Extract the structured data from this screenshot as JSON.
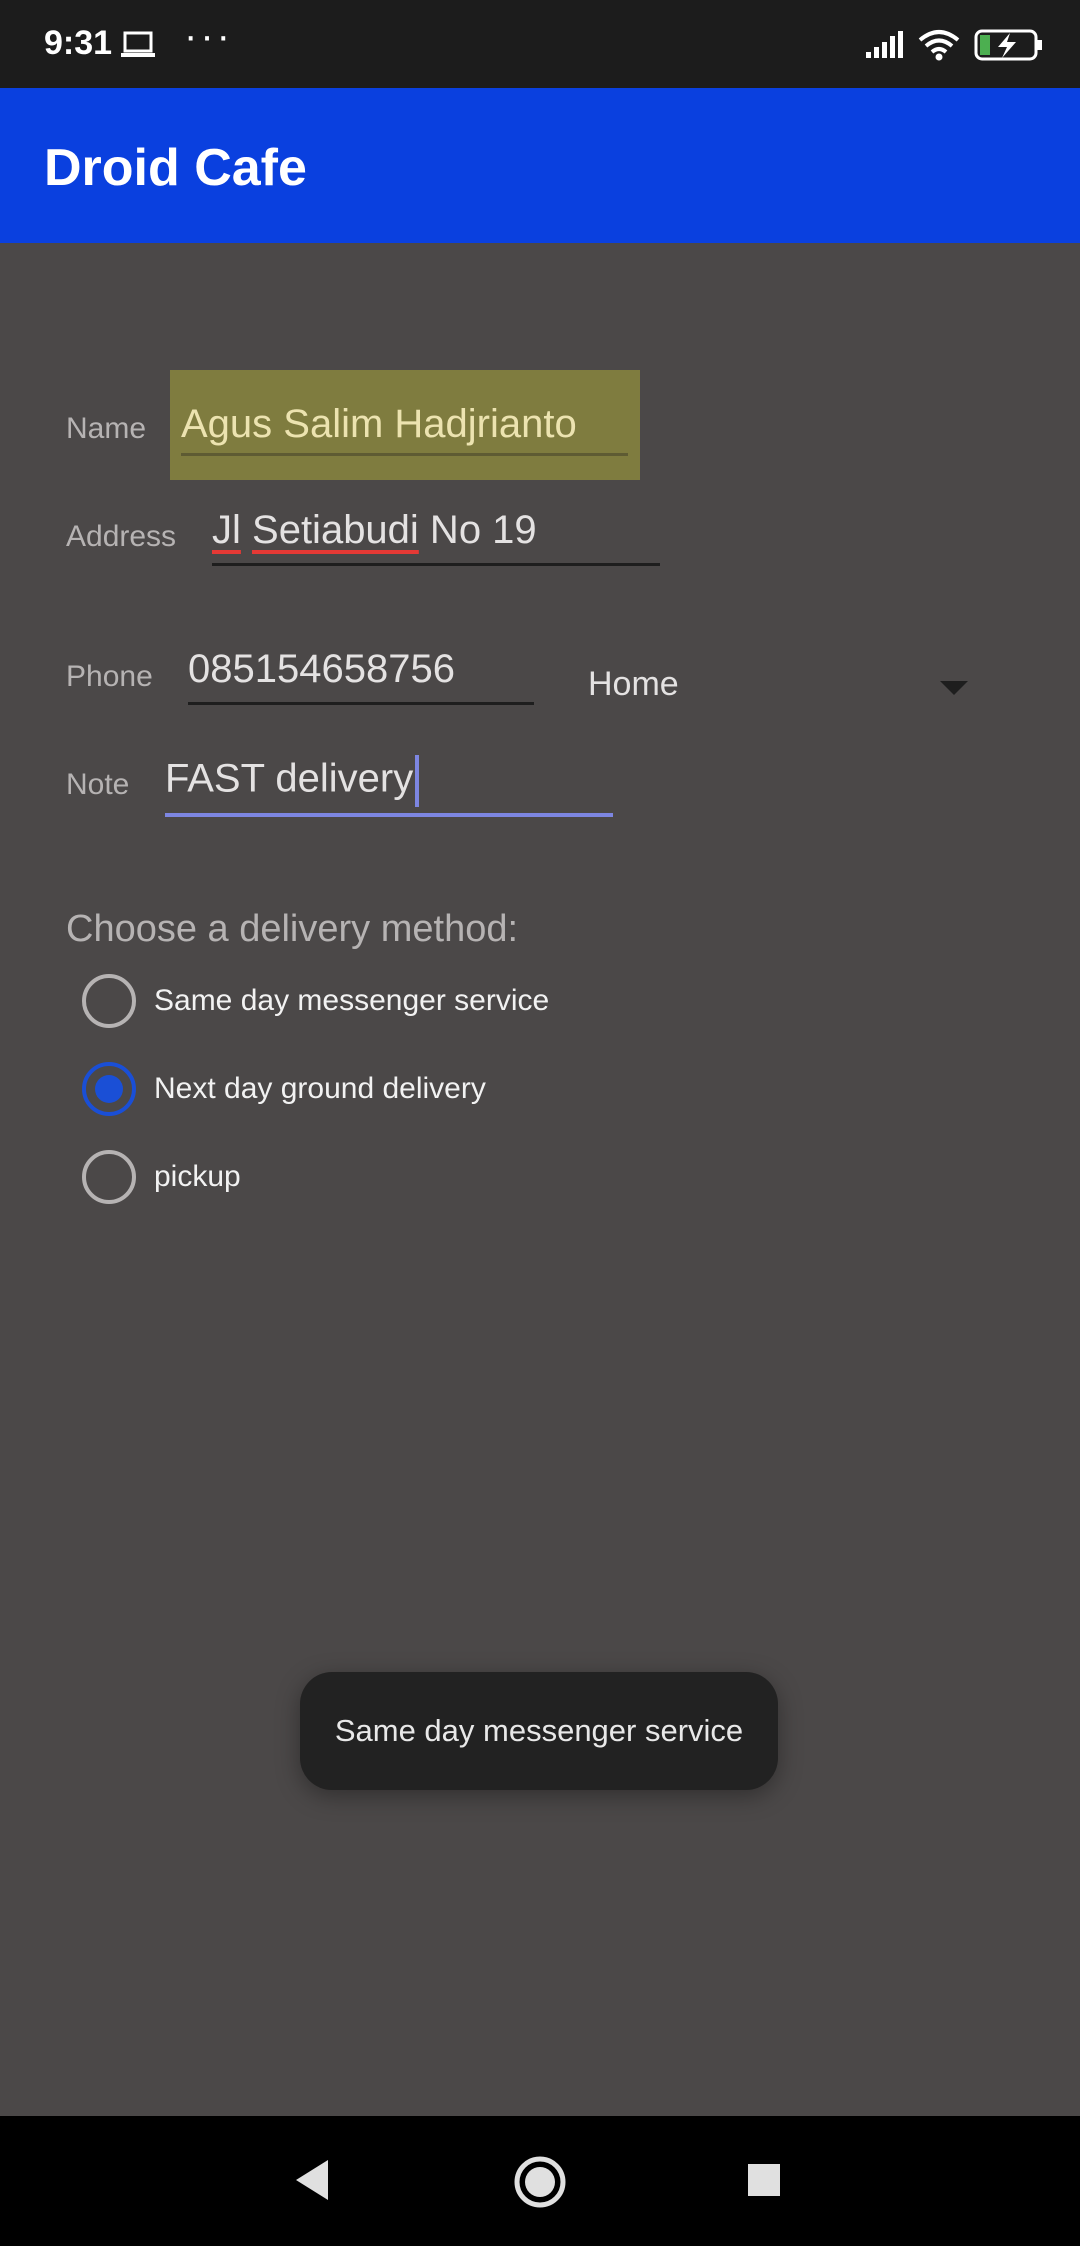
{
  "status_bar": {
    "time": "9:31",
    "dots": "···",
    "icons": [
      "laptop-icon",
      "signal-icon",
      "wifi-icon",
      "battery-charging-icon"
    ]
  },
  "app_bar": {
    "title": "Droid Cafe",
    "color": "#0a40df"
  },
  "form": {
    "name": {
      "label": "Name",
      "value": "Agus Salim Hadjrianto"
    },
    "address": {
      "label": "Address",
      "value_word1": "Jl",
      "value_word2": "Setiabudi",
      "value_rest": " No 19"
    },
    "phone": {
      "label": "Phone",
      "value": "085154658756",
      "type_selected": "Home"
    },
    "note": {
      "label": "Note",
      "value": "FAST delivery"
    }
  },
  "delivery": {
    "heading": "Choose a delivery method:",
    "options": [
      {
        "label": "Same day messenger service",
        "checked": false
      },
      {
        "label": "Next day ground delivery",
        "checked": true
      },
      {
        "label": "pickup",
        "checked": false
      }
    ]
  },
  "toast": {
    "text": "Same day messenger service"
  },
  "nav_bar": {
    "icons": [
      "back-icon",
      "home-icon",
      "recents-icon"
    ]
  }
}
